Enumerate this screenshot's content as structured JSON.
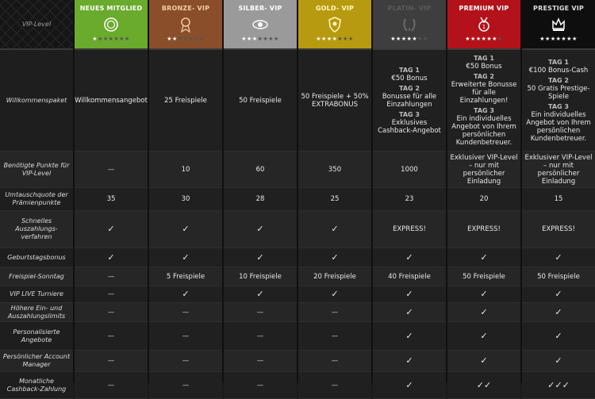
{
  "corner_label": "VIP-Level",
  "tiers": [
    {
      "name": "NEUES MITGLIED",
      "bg": "#6aaa2c",
      "fg": "#ffffff",
      "icon": "circle-badge-icon",
      "stars_filled": 1,
      "stars_total": 7
    },
    {
      "name": "BRONZE- VIP",
      "bg": "#8a4f2a",
      "fg": "#f3c9a5",
      "icon": "medal-icon",
      "stars_filled": 2,
      "stars_total": 7
    },
    {
      "name": "SILBER- VIP",
      "bg": "#9a9a9a",
      "fg": "#ffffff",
      "icon": "winged-badge-icon",
      "stars_filled": 3,
      "stars_total": 7
    },
    {
      "name": "GOLD- VIP",
      "bg": "#b89a10",
      "fg": "#fff8c0",
      "icon": "shield-icon",
      "stars_filled": 4,
      "stars_total": 7
    },
    {
      "name": "PLATIN- VIP",
      "bg": "#3e3e3e",
      "fg": "#5a5a5a",
      "icon": "laurel-wreath-icon",
      "stars_filled": 5,
      "stars_total": 7
    },
    {
      "name": "PREMIUM VIP",
      "bg": "#b3121a",
      "fg": "#ffffff",
      "icon": "premium-medal-icon",
      "stars_filled": 6,
      "stars_total": 7
    },
    {
      "name": "PRESTIGE VIP",
      "bg": "#0e0e0e",
      "fg": "#dcdcdc",
      "icon": "crown-icon",
      "stars_filled": 7,
      "stars_total": 7
    }
  ],
  "rows": [
    {
      "label": "Willkommenspaket",
      "type": "bonus",
      "cells": [
        [
          {
            "txt": "Willkommensangebot"
          }
        ],
        [
          {
            "txt": "25 Freispiele"
          }
        ],
        [
          {
            "txt": "50 Freispiele"
          }
        ],
        [
          {
            "txt": "50 Freispiele + 50% EXTRABONUS"
          }
        ],
        [
          {
            "day": "TAG 1",
            "txt": "€50 Bonus"
          },
          {
            "day": "TAG 2",
            "txt": "Bonusse für alle Einzahlungen"
          },
          {
            "day": "TAG 3",
            "txt": "Exklusives Cashback-Angebot"
          }
        ],
        [
          {
            "day": "TAG 1",
            "txt": "€50 Bonus"
          },
          {
            "day": "TAG 2",
            "txt": "Erweiterte Bonusse für alle Einzahlungen!"
          },
          {
            "day": "TAG 3",
            "txt": "Ein individuelles Angebot von Ihrem persönlichen Kundenbetreuer."
          }
        ],
        [
          {
            "day": "TAG 1",
            "txt": "€100 Bonus-Cash"
          },
          {
            "day": "TAG 2",
            "txt": "50 Gratis Prestige-Spiele"
          },
          {
            "day": "TAG 3",
            "txt": "Ein individuelles Angebot von Ihrem persönlichen Kundenbetreuer."
          }
        ]
      ]
    },
    {
      "label": "Benötigte Punkte für VIP-Level",
      "cells": [
        "—",
        "10",
        "60",
        "350",
        "1000",
        "Exklusiver VIP-Level – nur mit persönlicher Einladung",
        "Exklusiver VIP-Level – nur mit persönlicher Einladung"
      ]
    },
    {
      "label": "Umtauschquote der Prämienpunkte",
      "cells": [
        "35",
        "30",
        "28",
        "25",
        "23",
        "20",
        "15"
      ]
    },
    {
      "label": "Schnelles Auszahlungs-verfahren",
      "cells": [
        "✓",
        "✓",
        "✓",
        "✓",
        "EXPRESS!",
        "EXPRESS!",
        "EXPRESS!"
      ]
    },
    {
      "label": "Geburtstagsbonus",
      "cells": [
        "✓",
        "✓",
        "✓",
        "✓",
        "✓",
        "✓",
        "✓"
      ]
    },
    {
      "label": "Freispiel-Sonntag",
      "cells": [
        "—",
        "5 Freispiele",
        "10 Freispiele",
        "20 Freispiele",
        "40 Freispiele",
        "50 Freispiele",
        "50 Freispiele"
      ]
    },
    {
      "label": "VIP LIVE Turniere",
      "cells": [
        "—",
        "✓",
        "✓",
        "✓",
        "✓",
        "✓",
        "✓"
      ]
    },
    {
      "label": "Höhere Ein- und Auszahlungslimits",
      "cells": [
        "—",
        "—",
        "—",
        "—",
        "✓",
        "✓",
        "✓"
      ]
    },
    {
      "label": "Personalisierte Angebote",
      "cells": [
        "—",
        "—",
        "—",
        "—",
        "✓",
        "✓",
        "✓"
      ]
    },
    {
      "label": "Persönlicher Account Manager",
      "cells": [
        "—",
        "—",
        "—",
        "—",
        "✓",
        "✓",
        "✓"
      ]
    },
    {
      "label": "Monatliche Cashback-Zahlung",
      "cells": [
        "—",
        "—",
        "—",
        "—",
        "✓",
        "✓✓",
        "✓✓✓"
      ]
    }
  ]
}
